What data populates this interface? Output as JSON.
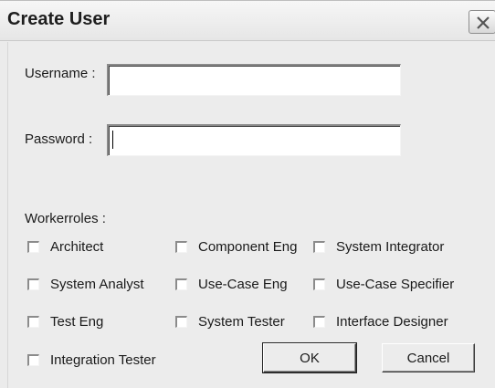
{
  "window": {
    "title": "Create User",
    "close_icon": "close-x-icon"
  },
  "form": {
    "username_label": "Username :",
    "username_value": "",
    "password_label": "Password :",
    "password_value": ""
  },
  "workerroles": {
    "label": "Workerroles :",
    "options": [
      {
        "label": "Architect",
        "checked": false
      },
      {
        "label": "Component Eng",
        "checked": false
      },
      {
        "label": "System Integrator",
        "checked": false
      },
      {
        "label": "System Analyst",
        "checked": false
      },
      {
        "label": "Use-Case Eng",
        "checked": false
      },
      {
        "label": "Use-Case Specifier",
        "checked": false
      },
      {
        "label": "Test Eng",
        "checked": false
      },
      {
        "label": "System Tester",
        "checked": false
      },
      {
        "label": "Interface Designer",
        "checked": false
      },
      {
        "label": "Integration Tester",
        "checked": false
      }
    ]
  },
  "buttons": {
    "ok_label": "OK",
    "cancel_label": "Cancel"
  }
}
